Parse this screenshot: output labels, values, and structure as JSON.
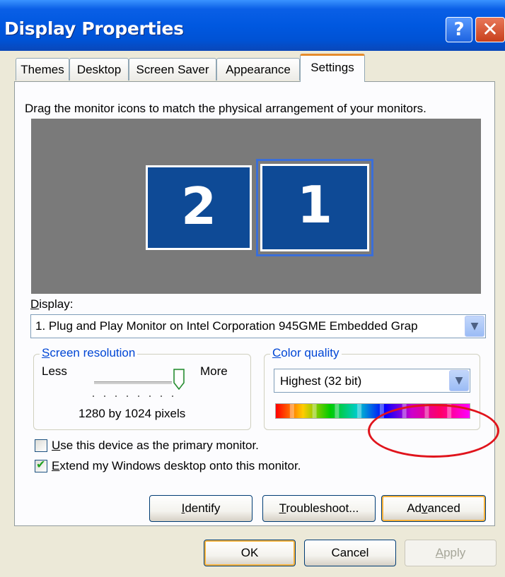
{
  "window": {
    "title": "Display Properties",
    "help_label": "?",
    "close_label": "✕"
  },
  "tabs": [
    {
      "label": "Themes"
    },
    {
      "label": "Desktop"
    },
    {
      "label": "Screen Saver"
    },
    {
      "label": "Appearance"
    },
    {
      "label": "Settings",
      "active": true
    }
  ],
  "settings": {
    "instruction": "Drag the monitor icons to match the physical arrangement of your monitors.",
    "monitors": [
      {
        "label": "2"
      },
      {
        "label": "1",
        "selected": true
      }
    ],
    "display_label_prefix": "D",
    "display_label_rest": "isplay:",
    "display_value": "1. Plug and Play Monitor on Intel Corporation 945GME Embedded Grap",
    "resolution": {
      "title_prefix": "S",
      "title_rest": "creen resolution",
      "less_label": "Less",
      "more_label": "More",
      "value": "1280 by 1024 pixels"
    },
    "color_quality": {
      "title_prefix": "C",
      "title_rest": "olor quality",
      "value": "Highest (32 bit)"
    },
    "checkboxes": [
      {
        "prefix": "U",
        "rest": "se this device as the primary monitor.",
        "checked": false
      },
      {
        "prefix": "E",
        "rest": "xtend my Windows desktop onto this monitor.",
        "checked": true
      }
    ],
    "buttons": {
      "identify_prefix": "I",
      "identify_rest": "dentify",
      "troubleshoot_prefix": "T",
      "troubleshoot_rest": "roubleshoot...",
      "advanced_pre": "Ad",
      "advanced_u": "v",
      "advanced_post": "anced"
    }
  },
  "footer": {
    "ok_label": "OK",
    "cancel_label": "Cancel",
    "apply_prefix": "A",
    "apply_rest": "pply"
  },
  "colors": {
    "titlebar": "#0058e0",
    "monitor_fill": "#0e4a96",
    "highlight_circle": "#e0141c",
    "active_tab_accent": "#e68b2c"
  }
}
